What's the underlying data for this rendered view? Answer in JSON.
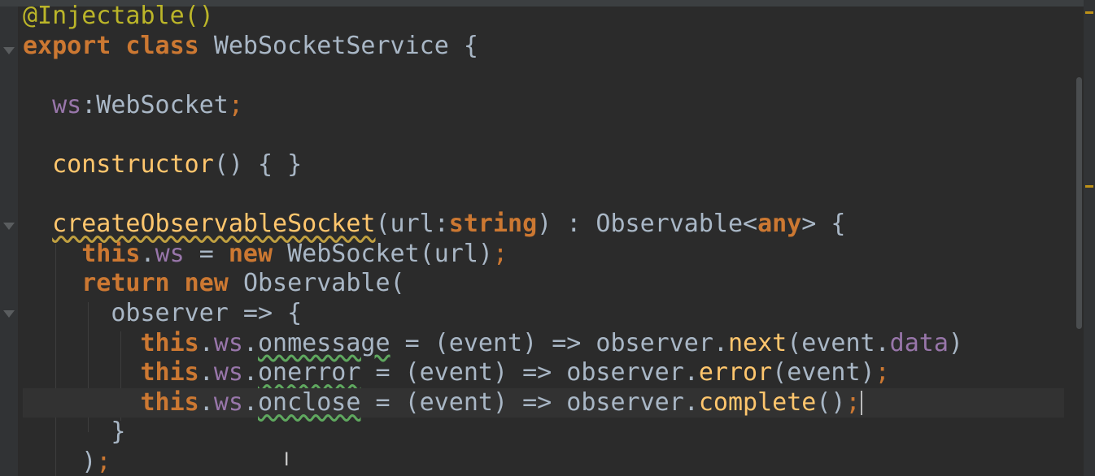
{
  "editor": {
    "language": "TypeScript",
    "colors": {
      "background": "#2b2b2b",
      "keyword": "#cc7832",
      "function": "#ffc66d",
      "property": "#9876aa",
      "plain": "#a9b7c6",
      "annotation": "#bbb529"
    },
    "cursor_icon": "text-ibeam-icon",
    "lines": [
      {
        "tokens": [
          [
            "ann",
            "@Injectable()"
          ]
        ]
      },
      {
        "tokens": [
          [
            "kw",
            "export class "
          ],
          [
            "plain",
            "WebSocketService {"
          ]
        ]
      },
      {
        "tokens": []
      },
      {
        "tokens": [
          [
            "plain",
            "  "
          ],
          [
            "prop",
            "ws"
          ],
          [
            "plain",
            ":WebSocket"
          ],
          [
            "semi",
            ";"
          ]
        ]
      },
      {
        "tokens": []
      },
      {
        "tokens": [
          [
            "plain",
            "  "
          ],
          [
            "fn",
            "constructor"
          ],
          [
            "plain",
            "() { }"
          ]
        ]
      },
      {
        "tokens": []
      },
      {
        "tokens": [
          [
            "plain",
            "  "
          ],
          [
            "fnwarn",
            "createObservableSocket"
          ],
          [
            "plain",
            "(url:"
          ],
          [
            "kw",
            "string"
          ],
          [
            "plain",
            ") : Observable<"
          ],
          [
            "kw",
            "any"
          ],
          [
            "plain",
            "> {"
          ]
        ]
      },
      {
        "tokens": [
          [
            "plain",
            "    "
          ],
          [
            "kw",
            "this"
          ],
          [
            "plain",
            "."
          ],
          [
            "prop",
            "ws"
          ],
          [
            "plain",
            " = "
          ],
          [
            "kw",
            "new "
          ],
          [
            "plain",
            "WebSocket(url)"
          ],
          [
            "semi",
            ";"
          ]
        ]
      },
      {
        "tokens": [
          [
            "plain",
            "    "
          ],
          [
            "kw",
            "return new "
          ],
          [
            "plain",
            "Observable("
          ]
        ]
      },
      {
        "tokens": [
          [
            "plain",
            "      observer => {"
          ]
        ]
      },
      {
        "tokens": [
          [
            "plain",
            "        "
          ],
          [
            "kw",
            "this"
          ],
          [
            "plain",
            "."
          ],
          [
            "prop",
            "ws"
          ],
          [
            "plain",
            "."
          ],
          [
            "typo",
            "onmessage"
          ],
          [
            "plain",
            " = (event) => observer."
          ],
          [
            "fn",
            "next"
          ],
          [
            "plain",
            "(event."
          ],
          [
            "prop",
            "data"
          ],
          [
            "plain",
            ")"
          ]
        ]
      },
      {
        "tokens": [
          [
            "plain",
            "        "
          ],
          [
            "kw",
            "this"
          ],
          [
            "plain",
            "."
          ],
          [
            "prop",
            "ws"
          ],
          [
            "plain",
            "."
          ],
          [
            "typo",
            "onerror"
          ],
          [
            "plain",
            " = (event) => observer."
          ],
          [
            "fn",
            "error"
          ],
          [
            "plain",
            "(event)"
          ],
          [
            "semi",
            ";"
          ]
        ]
      },
      {
        "tokens": [
          [
            "plain",
            "        "
          ],
          [
            "kw",
            "this"
          ],
          [
            "plain",
            "."
          ],
          [
            "prop",
            "ws"
          ],
          [
            "plain",
            "."
          ],
          [
            "typo",
            "onclose"
          ],
          [
            "plain",
            " = (event) => observer."
          ],
          [
            "fn",
            "complete"
          ],
          [
            "plain",
            "()"
          ],
          [
            "semi",
            ";"
          ],
          [
            "caret",
            ""
          ]
        ]
      },
      {
        "tokens": [
          [
            "plain",
            "      }"
          ]
        ]
      },
      {
        "tokens": [
          [
            "plain",
            "    )"
          ],
          [
            "semi",
            ";"
          ]
        ]
      }
    ]
  }
}
